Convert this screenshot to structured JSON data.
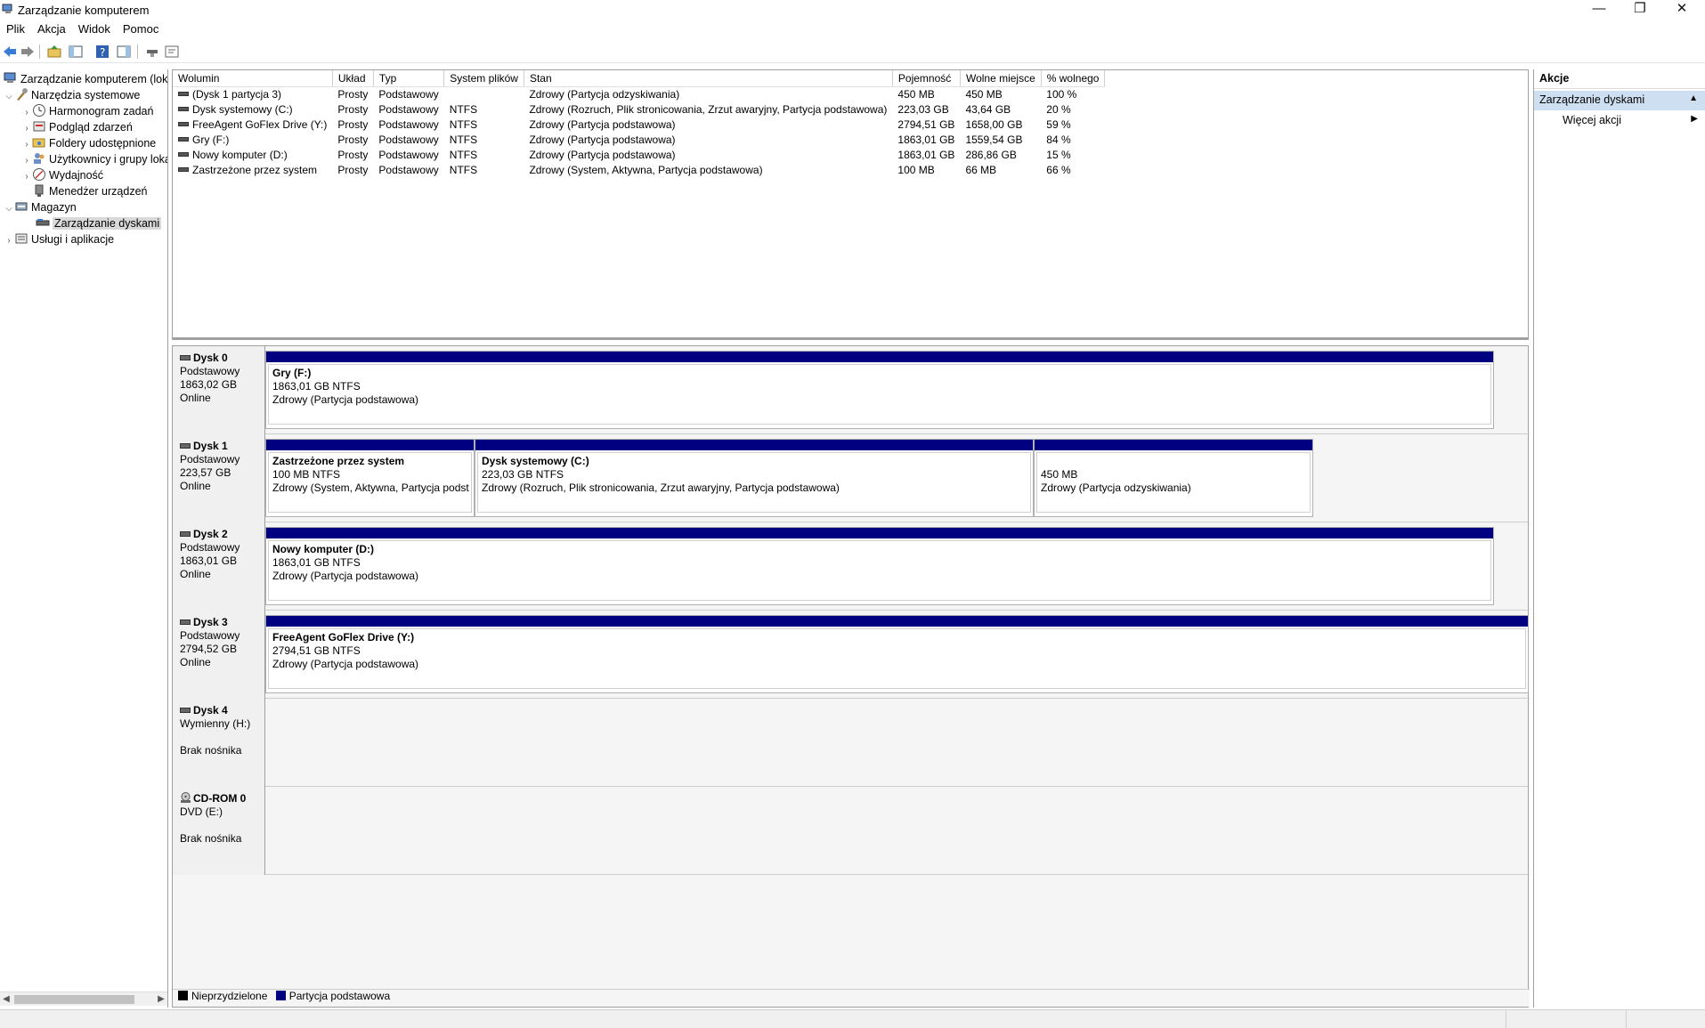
{
  "window": {
    "title": "Zarządzanie komputerem",
    "minimize": "—",
    "restore": "❐",
    "close": "✕"
  },
  "menu": [
    "Plik",
    "Akcja",
    "Widok",
    "Pomoc"
  ],
  "tree": {
    "root": "Zarządzanie komputerem (lokalny)",
    "system_tools": "Narzędzia systemowe",
    "task_scheduler": "Harmonogram zadań",
    "event_viewer": "Podgląd zdarzeń",
    "shared_folders": "Foldery udostępnione",
    "users_groups": "Użytkownicy i grupy lokalne",
    "performance": "Wydajność",
    "device_manager": "Menedżer urządzeń",
    "storage": "Magazyn",
    "disk_management": "Zarządzanie dyskami",
    "services_apps": "Usługi i aplikacje"
  },
  "volumes": {
    "headers": [
      "Wolumin",
      "Układ",
      "Typ",
      "System plików",
      "Stan",
      "Pojemność",
      "Wolne miejsce",
      "% wolnego"
    ],
    "rows": [
      [
        "(Dysk 1 partycja 3)",
        "Prosty",
        "Podstawowy",
        "",
        "Zdrowy (Partycja odzyskiwania)",
        "450 MB",
        "450 MB",
        "100 %"
      ],
      [
        "Dysk systemowy (C:)",
        "Prosty",
        "Podstawowy",
        "NTFS",
        "Zdrowy (Rozruch, Plik stronicowania, Zrzut awaryjny, Partycja podstawowa)",
        "223,03 GB",
        "43,64 GB",
        "20 %"
      ],
      [
        "FreeAgent GoFlex Drive (Y:)",
        "Prosty",
        "Podstawowy",
        "NTFS",
        "Zdrowy (Partycja podstawowa)",
        "2794,51 GB",
        "1658,00 GB",
        "59 %"
      ],
      [
        "Gry (F:)",
        "Prosty",
        "Podstawowy",
        "NTFS",
        "Zdrowy (Partycja podstawowa)",
        "1863,01 GB",
        "1559,54 GB",
        "84 %"
      ],
      [
        "Nowy komputer (D:)",
        "Prosty",
        "Podstawowy",
        "NTFS",
        "Zdrowy (Partycja podstawowa)",
        "1863,01 GB",
        "286,86 GB",
        "15 %"
      ],
      [
        "Zastrzeżone przez system",
        "Prosty",
        "Podstawowy",
        "NTFS",
        "Zdrowy (System, Aktywna, Partycja podstawowa)",
        "100 MB",
        "66 MB",
        "66 %"
      ]
    ]
  },
  "disks": {
    "d0": {
      "name": "Dysk 0",
      "type": "Podstawowy",
      "size": "1863,02 GB",
      "status": "Online",
      "p1": {
        "title": "Gry  (F:)",
        "size": "1863,01 GB NTFS",
        "status": "Zdrowy (Partycja podstawowa)"
      }
    },
    "d1": {
      "name": "Dysk 1",
      "type": "Podstawowy",
      "size": "223,57 GB",
      "status": "Online",
      "p1": {
        "title": "Zastrzeżone przez system",
        "size": "100 MB NTFS",
        "status": "Zdrowy (System, Aktywna, Partycja podst"
      },
      "p2": {
        "title": "Dysk systemowy  (C:)",
        "size": "223,03 GB NTFS",
        "status": "Zdrowy (Rozruch, Plik stronicowania, Zrzut awaryjny, Partycja podstawowa)"
      },
      "p3": {
        "size": "450 MB",
        "status": "Zdrowy (Partycja odzyskiwania)"
      }
    },
    "d2": {
      "name": "Dysk 2",
      "type": "Podstawowy",
      "size": "1863,01 GB",
      "status": "Online",
      "p1": {
        "title": "Nowy komputer  (D:)",
        "size": "1863,01 GB NTFS",
        "status": "Zdrowy (Partycja podstawowa)"
      }
    },
    "d3": {
      "name": "Dysk 3",
      "type": "Podstawowy",
      "size": "2794,52 GB",
      "status": "Online",
      "p1": {
        "title": "FreeAgent GoFlex Drive  (Y:)",
        "size": "2794,51 GB NTFS",
        "status": "Zdrowy (Partycja podstawowa)"
      }
    },
    "d4": {
      "name": "Dysk 4",
      "type": "Wymienny (H:)",
      "status": "Brak nośnika"
    },
    "cd0": {
      "name": "CD-ROM 0",
      "type": "DVD (E:)",
      "status": "Brak nośnika"
    }
  },
  "legend": {
    "unallocated": "Nieprzydzielone",
    "primary": "Partycja podstawowa",
    "unallocated_color": "#000000",
    "primary_color": "#000080"
  },
  "actions": {
    "header": "Akcje",
    "section": "Zarządzanie dyskami",
    "more": "Więcej akcji"
  }
}
